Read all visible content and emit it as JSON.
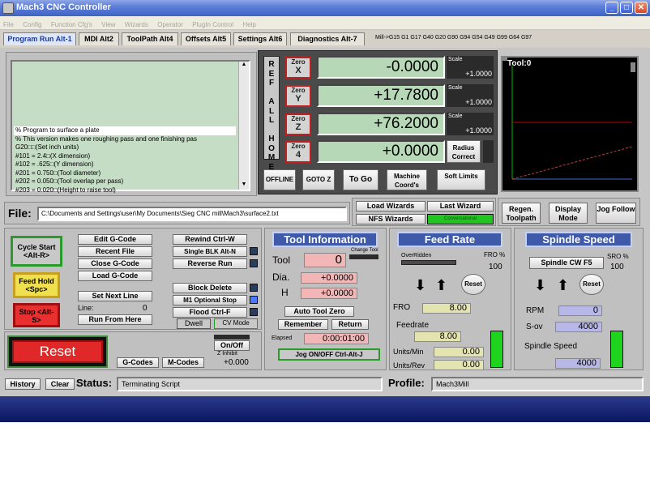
{
  "window": {
    "title": "Mach3 CNC Controller"
  },
  "menu": [
    "File",
    "Config",
    "Function Cfg's",
    "View",
    "Wizards",
    "Operator",
    "PlugIn Control",
    "Help"
  ],
  "tabs": [
    {
      "label": "Program Run Alt-1",
      "active": true
    },
    {
      "label": "MDI Alt2",
      "active": false
    },
    {
      "label": "ToolPath Alt4",
      "active": false
    },
    {
      "label": "Offsets Alt5",
      "active": false
    },
    {
      "label": "Settings Alt6",
      "active": false
    },
    {
      "label": "Diagnostics Alt-7",
      "active": false
    }
  ],
  "modal_gcodes": "Mill->G15  G1 G17 G40 G20 G90 G94 G54 G49 G99 G64 G97",
  "gcode_lines": [
    "% Program to surface a plate",
    "% This version makes one roughing pass and one finishing pas",
    "G20□□(Set inch units)",
    "#101 = 2.4□(X dimension)",
    "#102 = .625□(Y dimension)",
    "#201 = 0.750□(Tool diameter)",
    "#202 = 0.050□(Tool overlap per pass)",
    "#203 = 0.020□(Height to raise tool)"
  ],
  "ref_all_home": "REF ALL HOME",
  "axes": [
    {
      "zero_label": "Zero",
      "axis": "X",
      "value": "-0.0000",
      "scale_label": "Scale",
      "scale": "+1.0000"
    },
    {
      "zero_label": "Zero",
      "axis": "Y",
      "value": "+17.7800",
      "scale_label": "Scale",
      "scale": "+1.0000"
    },
    {
      "zero_label": "Zero",
      "axis": "Z",
      "value": "+76.2000",
      "scale_label": "Scale",
      "scale": "+1.0000"
    },
    {
      "zero_label": "Zero",
      "axis": "4",
      "value": "+0.0000",
      "scale_label": "Radius Correct",
      "scale": ""
    }
  ],
  "dro_buttons": {
    "offline": "OFFLINE",
    "gotoz": "GOTO Z",
    "togo": "To Go",
    "machine": "Machine Coord's",
    "soft": "Soft Limits"
  },
  "toolpath": {
    "label": "Tool:0"
  },
  "file": {
    "label": "File:",
    "path": "C:\\Documents and Settings\\user\\My Documents\\Sieg CNC mill\\Mach3\\surface2.txt"
  },
  "wizards": {
    "load": "Load Wizards",
    "last": "Last Wizard",
    "nfs": "NFS Wizards",
    "conv": "Conversational"
  },
  "view_buttons": {
    "regen": "Regen. Toolpath",
    "display": "Display Mode",
    "jog": "Jog Follow"
  },
  "cycle": {
    "start": "Cycle Start <Alt-R>",
    "feedhold": "Feed Hold <Spc>",
    "stop": "Stop <Alt-S>"
  },
  "gcode_buttons": {
    "edit": "Edit G-Code",
    "recent": "Recent File",
    "close": "Close G-Code",
    "load": "Load G-Code",
    "setnext": "Set Next Line",
    "line_label": "Line:",
    "line_value": "0",
    "runfrom": "Run From Here",
    "rewind": "Rewind Ctrl-W",
    "single": "Single BLK Alt-N",
    "reverse": "Reverse Run",
    "blockdel": "Block Delete",
    "m1": "M1 Optional Stop",
    "flood": "Flood Ctrl-F",
    "dwell": "Dwell",
    "cvmode": "CV Mode"
  },
  "reset": {
    "label": "Reset",
    "gcodes": "G-Codes",
    "mcodes": "M-Codes",
    "onoff": "On/Off",
    "zinhibit": "Z Inhibit",
    "zinhibit_value": "+0.000"
  },
  "tool_info": {
    "title": "Tool Information",
    "tool_label": "Tool",
    "tool_value": "0",
    "change_label": "Change Tool",
    "dia_label": "Dia.",
    "dia_value": "+0.0000",
    "h_label": "H",
    "h_value": "+0.0000",
    "autozero": "Auto Tool Zero",
    "remember": "Remember",
    "return": "Return",
    "elapsed_label": "Elapsed",
    "elapsed_value": "0:00:01:00",
    "jog": "Jog ON/OFF Ctrl-Alt-J"
  },
  "feed": {
    "title": "Feed Rate",
    "overridden": "OverRidden",
    "fro_label": "FRO %",
    "fro_value": "100",
    "reset": "Reset",
    "fro": "FRO",
    "fro_field": "8.00",
    "feedrate_label": "Feedrate",
    "feedrate_value": "8.00",
    "upm_label": "Units/Min",
    "upm_value": "0.00",
    "upr_label": "Units/Rev",
    "upr_value": "0.00"
  },
  "spindle": {
    "title": "Spindle Speed",
    "cw": "Spindle CW F5",
    "sro_label": "SRO %",
    "sro_value": "100",
    "reset": "Reset",
    "rpm_label": "RPM",
    "rpm_value": "0",
    "sov_label": "S-ov",
    "sov_value": "4000",
    "speed_label": "Spindle Speed",
    "speed_value": "4000"
  },
  "status": {
    "history": "History",
    "clear": "Clear",
    "label": "Status:",
    "message": "Terminating Script",
    "profile_label": "Profile:",
    "profile": "Mach3Mill"
  }
}
